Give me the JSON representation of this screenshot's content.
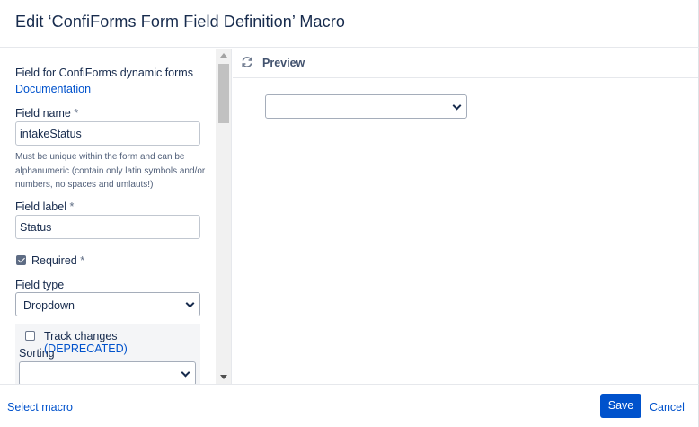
{
  "dialog": {
    "title": "Edit ‘ConfiForms Form Field Definition’ Macro"
  },
  "form": {
    "intro": "Field for ConfiForms dynamic forms",
    "documentation_link": "Documentation",
    "field_name": {
      "label": "Field name",
      "required_mark": "*",
      "value": "intakeStatus",
      "hint": "Must be unique within the form and can be alphanumeric (contain only latin symbols and/or numbers, no spaces and umlauts!)"
    },
    "field_label": {
      "label": "Field label",
      "required_mark": "*",
      "value": "Status"
    },
    "required": {
      "label": "Required",
      "required_mark": "*",
      "checked": true
    },
    "field_type": {
      "label": "Field type",
      "value": "Dropdown"
    },
    "track_changes": {
      "label": "Track changes",
      "deprecated_tag": "(DEPRECATED)",
      "checked": false
    },
    "sorting": {
      "label": "Sorting",
      "value": ""
    }
  },
  "preview": {
    "title": "Preview",
    "icon": "refresh-icon",
    "dropdown_value": ""
  },
  "footer": {
    "select_macro": "Select macro",
    "save": "Save",
    "cancel": "Cancel"
  },
  "colors": {
    "accent": "#0052cc",
    "text": "#172b4d",
    "border": "#c1c7d0"
  }
}
